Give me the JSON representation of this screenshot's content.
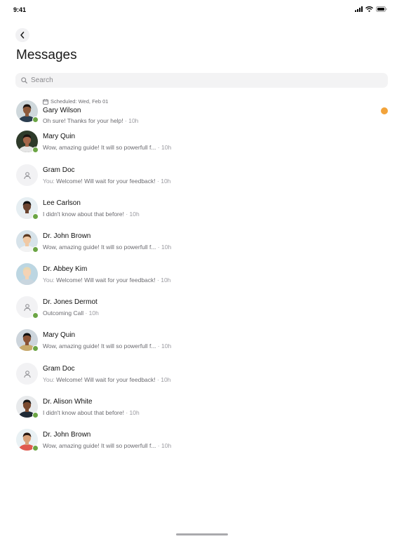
{
  "status_bar": {
    "time": "9:41"
  },
  "header": {
    "title": "Messages"
  },
  "search": {
    "placeholder": "Search"
  },
  "colors": {
    "online": "#6ba544",
    "unread": "#f2a33a"
  },
  "conversations": [
    {
      "name": "Gary Wilson",
      "prefix": "",
      "message": "Oh sure! Thanks for your help!",
      "time": "· 10h",
      "scheduled": "Scheduled: Wed, Feb 01",
      "avatar": "photo",
      "online": true,
      "unread": true
    },
    {
      "name": "Mary Quin",
      "prefix": "",
      "message": "Wow, amazing guide! It will so powerfull f...",
      "time": "· 10h",
      "scheduled": "",
      "avatar": "photo",
      "online": true,
      "unread": false
    },
    {
      "name": "Gram Doc",
      "prefix": "You:",
      "message": "Welcome! Will wait for your feedback!",
      "time": "· 10h",
      "scheduled": "",
      "avatar": "placeholder",
      "online": false,
      "unread": false
    },
    {
      "name": "Lee Carlson",
      "prefix": "",
      "message": "I didn't know about that before!",
      "time": "· 10h",
      "scheduled": "",
      "avatar": "photo",
      "online": true,
      "unread": false
    },
    {
      "name": "Dr. John Brown",
      "prefix": "",
      "message": "Wow, amazing guide! It will so powerfull f...",
      "time": "· 10h",
      "scheduled": "",
      "avatar": "photo",
      "online": true,
      "unread": false
    },
    {
      "name": "Dr. Abbey Kim",
      "prefix": "You:",
      "message": "Welcome! Will wait for your feedback!",
      "time": "· 10h",
      "scheduled": "",
      "avatar": "photo",
      "online": false,
      "unread": false
    },
    {
      "name": "Dr. Jones Dermot",
      "prefix": "",
      "message": "Outcoming Call",
      "time": "· 10h",
      "scheduled": "",
      "avatar": "placeholder",
      "online": true,
      "unread": false
    },
    {
      "name": "Mary Quin",
      "prefix": "",
      "message": "Wow, amazing guide! It will so powerfull f...",
      "time": "· 10h",
      "scheduled": "",
      "avatar": "photo",
      "online": true,
      "unread": false
    },
    {
      "name": "Gram Doc",
      "prefix": "You:",
      "message": "Welcome! Will wait for your feedback!",
      "time": "· 10h",
      "scheduled": "",
      "avatar": "placeholder",
      "online": false,
      "unread": false
    },
    {
      "name": "Dr. Alison White",
      "prefix": "",
      "message": "I didn't know about that before!",
      "time": "· 10h",
      "scheduled": "",
      "avatar": "photo",
      "online": true,
      "unread": false
    },
    {
      "name": "Dr. John Brown",
      "prefix": "",
      "message": "Wow, amazing guide! It will so powerfull f...",
      "time": "· 10h",
      "scheduled": "",
      "avatar": "photo",
      "online": true,
      "unread": false
    }
  ]
}
